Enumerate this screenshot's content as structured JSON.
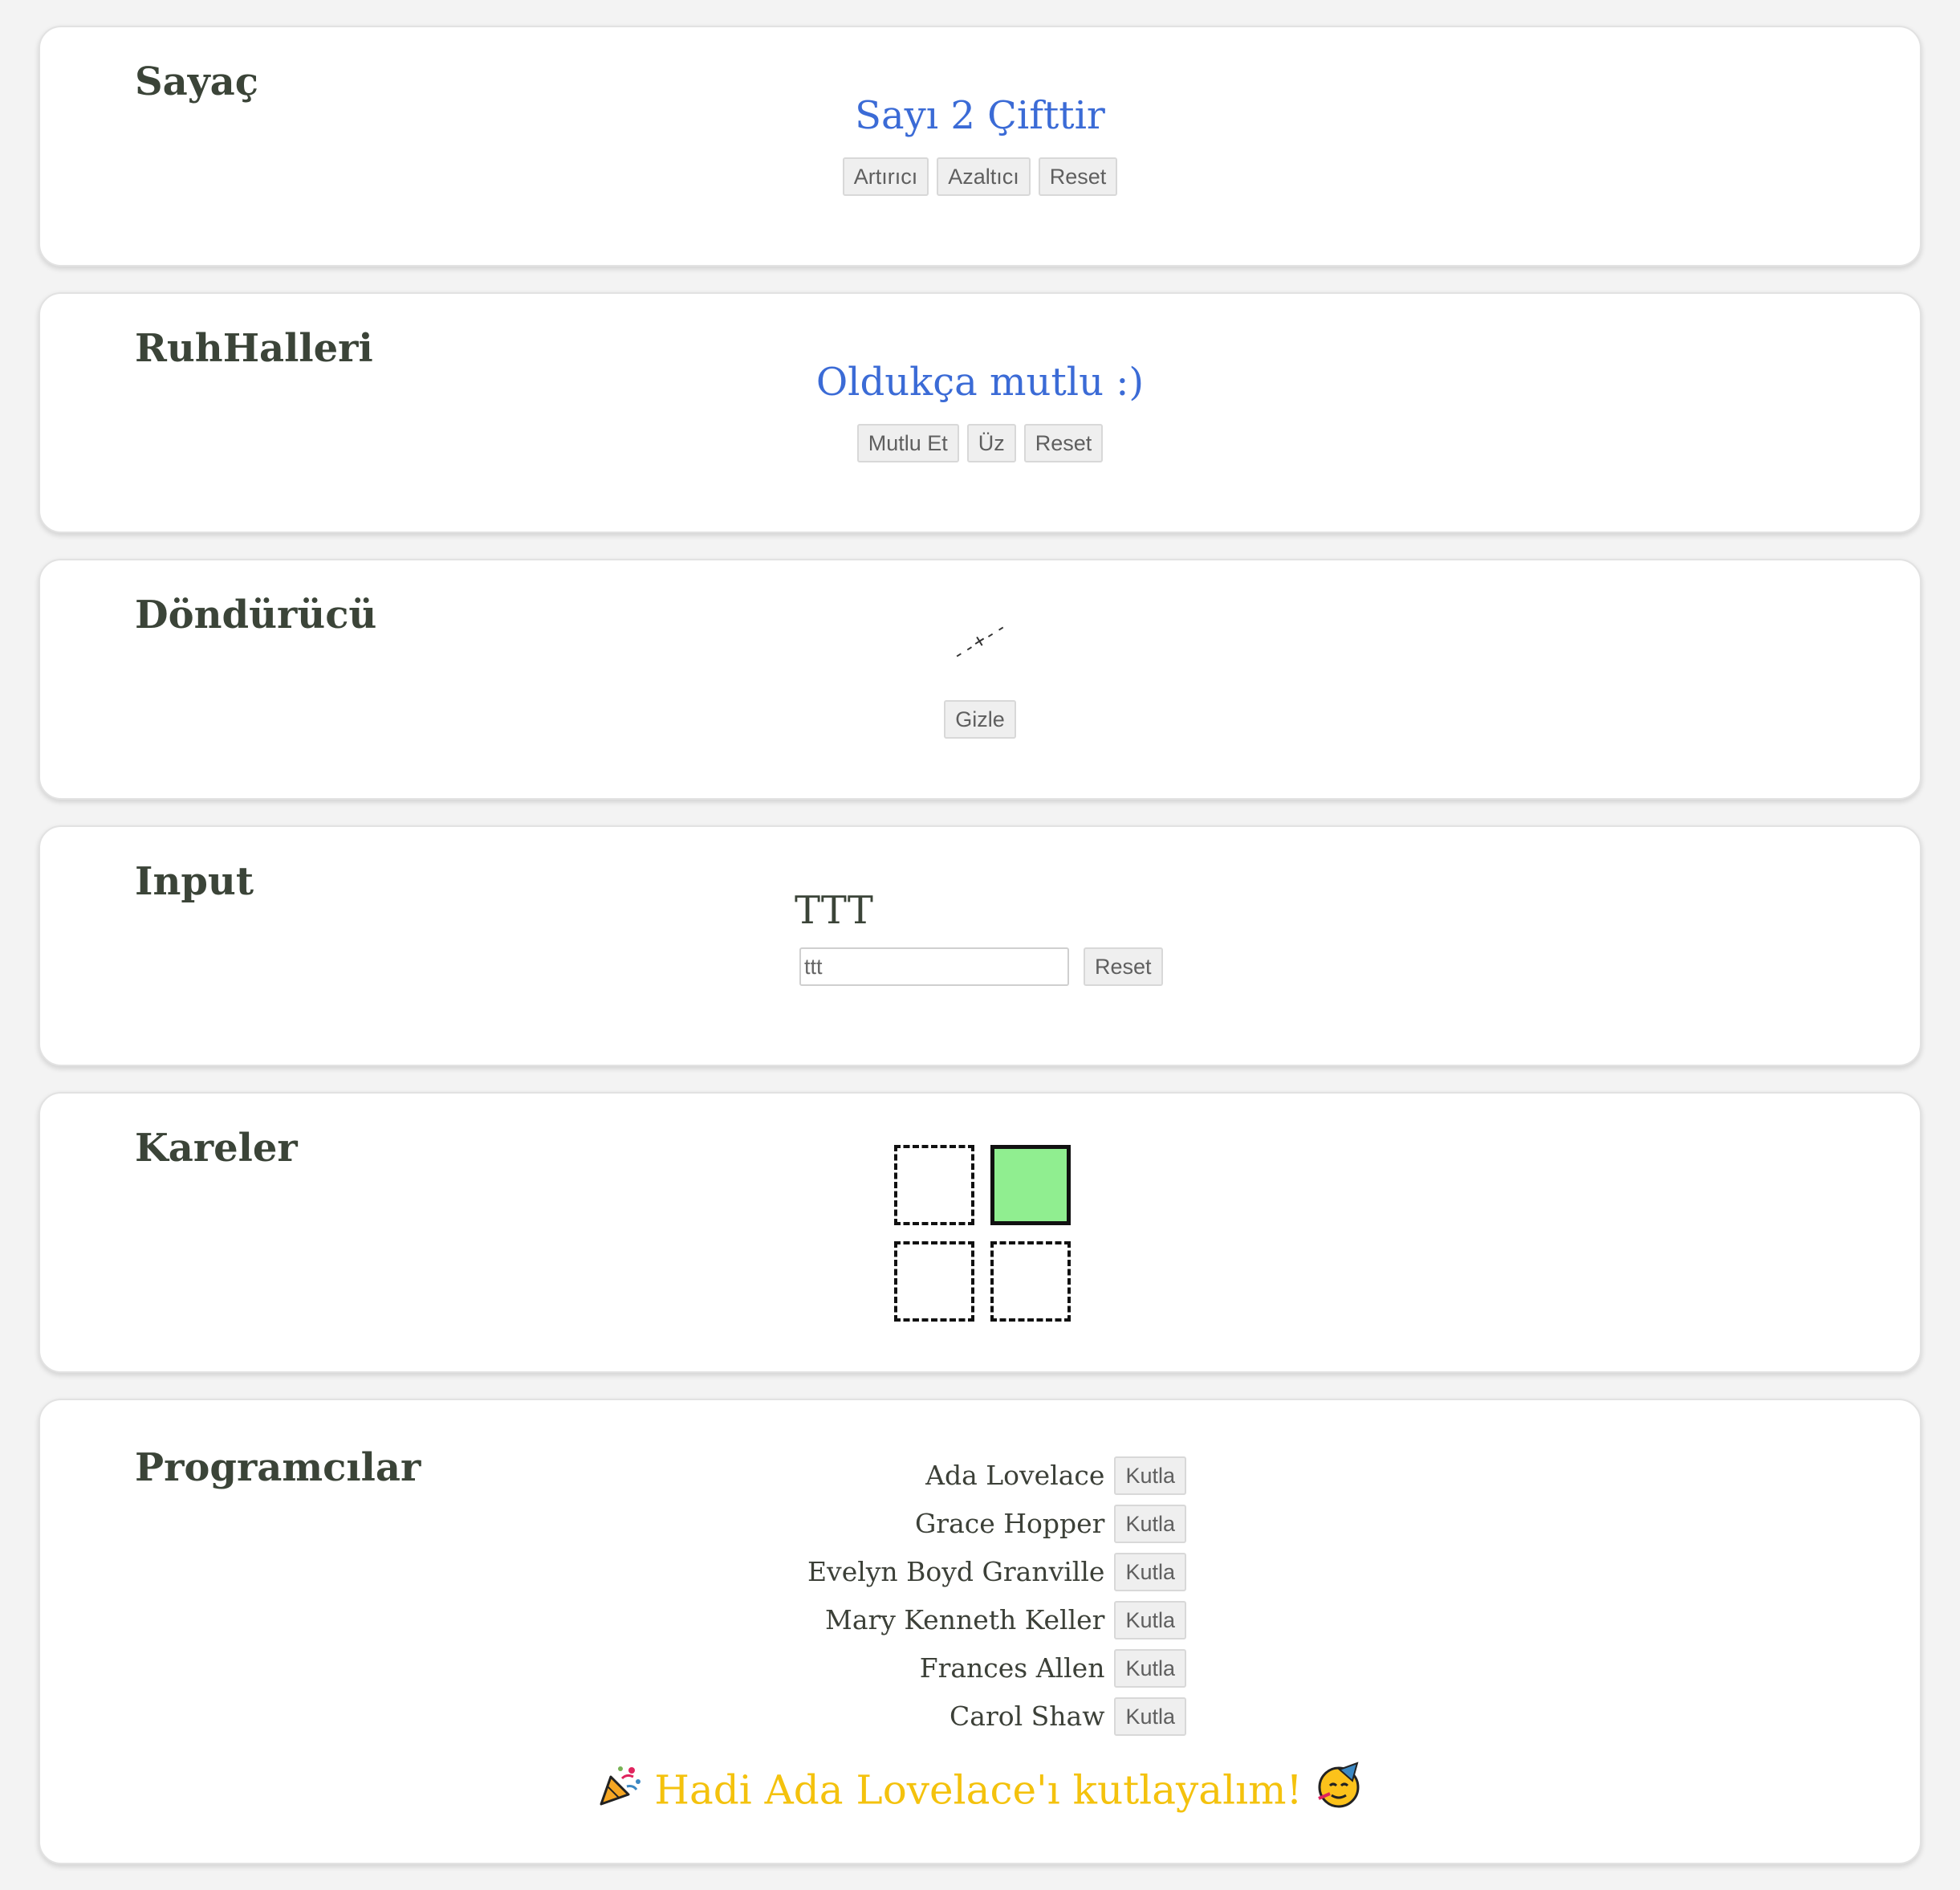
{
  "sayac": {
    "title": "Sayaç",
    "message": "Sayı 2 Çifttir",
    "buttons": [
      "Artırıcı",
      "Azaltıcı",
      "Reset"
    ]
  },
  "ruhhalleri": {
    "title": "RuhHalleri",
    "message": "Oldukça mutlu :)",
    "buttons": [
      "Mutlu Et",
      "Üz",
      "Reset"
    ]
  },
  "dondurucu": {
    "title": "Döndürücü",
    "spinner_glyph": "--+--",
    "button": "Gizle"
  },
  "input": {
    "title": "Input",
    "display": "TTT",
    "value": "ttt",
    "button": "Reset"
  },
  "kareler": {
    "title": "Kareler",
    "active_index": 1,
    "active_color": "#90ee90"
  },
  "programcilar": {
    "title": "Programcılar",
    "people": [
      "Ada Lovelace",
      "Grace Hopper",
      "Evelyn Boyd Granville",
      "Mary Kenneth Keller",
      "Frances Allen",
      "Carol Shaw"
    ],
    "button": "Kutla",
    "celebration": "Hadi Ada Lovelace'ı kutlayalım!",
    "celebration_color": "#f4c20d"
  }
}
